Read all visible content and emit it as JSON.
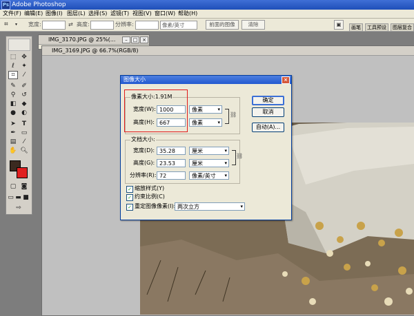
{
  "app": {
    "title": "Adobe Photoshop"
  },
  "menu": [
    "文件(F)",
    "编辑(E)",
    "图像(I)",
    "图层(L)",
    "选择(S)",
    "滤镜(T)",
    "视图(V)",
    "窗口(W)",
    "帮助(H)"
  ],
  "options_bar": {
    "width_label": "宽度:",
    "height_label": "高度:",
    "resolution_label": "分辨率:",
    "unit_value": "像素/英寸",
    "front_image_button": "前面的图像",
    "clear_button": "清除",
    "panel_tabs": [
      "画笔",
      "工具预设",
      "图层复合"
    ]
  },
  "documents": [
    {
      "title": "IMG_3170.JPG @ 25%(..."
    },
    {
      "title": "IMG_3169.JPG @ 66.7%(RGB/8)"
    }
  ],
  "dialog": {
    "title": "图像大小",
    "pixel_dim_label": "像素大小:1.91M",
    "width_label": "宽度(W):",
    "width_value": "1000",
    "width_unit": "像素",
    "height_label": "高度(H):",
    "height_value": "667",
    "height_unit": "像素",
    "doc_size_label": "文档大小:",
    "doc_width_label": "宽度(D):",
    "doc_width_value": "35.28",
    "doc_width_unit": "厘米",
    "doc_height_label": "高度(G):",
    "doc_height_value": "23.53",
    "doc_height_unit": "厘米",
    "resolution_label": "分辨率(R):",
    "resolution_value": "72",
    "resolution_unit": "像素/英寸",
    "scale_styles": "缩放样式(Y)",
    "constrain": "约束比例(C)",
    "resample": "重定图像像素(I):",
    "resample_method": "两次立方",
    "ok": "确定",
    "cancel": "取消",
    "auto": "自动(A)..."
  },
  "colors": {
    "highlight": "#e01818",
    "foreground": "#3b2a20",
    "background": "#e02020"
  }
}
